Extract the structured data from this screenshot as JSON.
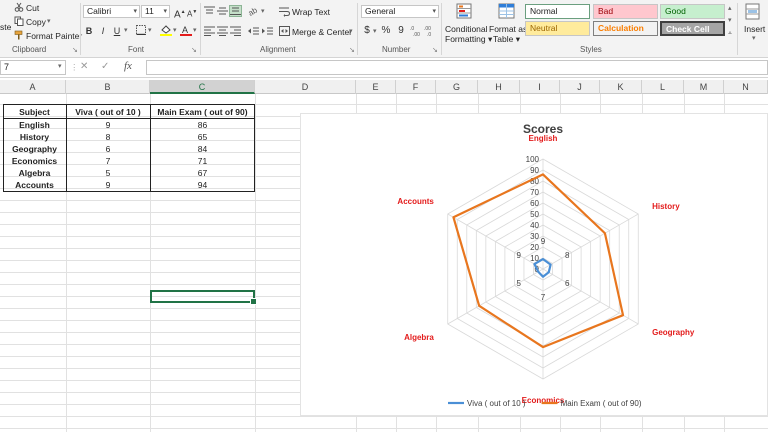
{
  "ribbon": {
    "clipboard": {
      "cut": "Cut",
      "copy": "Copy",
      "paste_partial": "ste",
      "format_painter": "Format Painter",
      "group_label": "Clipboard"
    },
    "font": {
      "name": "Calibri",
      "size": "11",
      "grow": "A",
      "shrink": "A",
      "bold": "B",
      "italic": "I",
      "underline": "U",
      "group_label": "Font"
    },
    "alignment": {
      "wrap_text": "Wrap Text",
      "merge_center": "Merge & Center",
      "group_label": "Alignment"
    },
    "number": {
      "format": "General",
      "currency": "$",
      "percent": "%",
      "comma": "9",
      "group_label": "Number"
    },
    "styles": {
      "conditional_formatting_1": "Conditional",
      "conditional_formatting_2": "Formatting",
      "format_table_1": "Format as",
      "format_table_2": "Table",
      "normal": "Normal",
      "bad": "Bad",
      "good": "Good",
      "neutral": "Neutral",
      "calculation": "Calculation",
      "check_cell": "Check Cell",
      "group_label": "Styles"
    },
    "cells": {
      "insert": "Insert"
    }
  },
  "formula_bar": {
    "name_box": "7",
    "cancel": "✕",
    "enter": "✓",
    "fx": "fx",
    "value": ""
  },
  "columns": [
    "A",
    "B",
    "C",
    "D",
    "E",
    "F",
    "G",
    "H",
    "I",
    "J",
    "K",
    "L",
    "M",
    "N"
  ],
  "table": {
    "headers": [
      "Subject",
      "Viva ( out of 10 )",
      "Main Exam ( out of 90)"
    ],
    "rows": [
      [
        "English",
        "9",
        "86"
      ],
      [
        "History",
        "8",
        "65"
      ],
      [
        "Geography",
        "6",
        "84"
      ],
      [
        "Economics",
        "7",
        "71"
      ],
      [
        "Algebra",
        "5",
        "67"
      ],
      [
        "Accounts",
        "9",
        "94"
      ]
    ]
  },
  "colors": {
    "excel_green": "#217346",
    "viva_series": "#4a8fd6",
    "main_series": "#e8761e",
    "category_label": "#e31b1b"
  },
  "chart_data": {
    "type": "radar",
    "title": "Scores",
    "categories": [
      "English",
      "History",
      "Geography",
      "Economics",
      "Algebra",
      "Accounts"
    ],
    "series": [
      {
        "name": "Viva ( out of 10 )",
        "values": [
          9,
          8,
          6,
          7,
          5,
          9
        ],
        "color": "#4a8fd6"
      },
      {
        "name": "Main Exam ( out of 90)",
        "values": [
          86,
          65,
          84,
          71,
          67,
          94
        ],
        "color": "#e8761e"
      }
    ],
    "axis_ticks": [
      "0",
      "10",
      "20",
      "30",
      "40",
      "50",
      "60",
      "70",
      "80",
      "90",
      "100"
    ],
    "axis_range": [
      0,
      100
    ],
    "legend_position": "bottom",
    "grid": true
  }
}
